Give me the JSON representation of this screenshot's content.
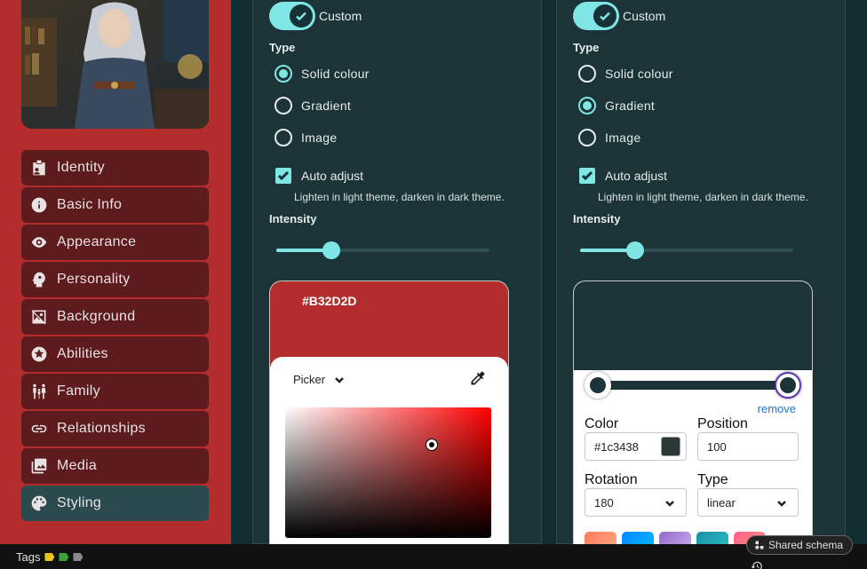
{
  "sidebar": {
    "items": [
      {
        "label": "Identity",
        "icon": "id-badge-icon",
        "active": false
      },
      {
        "label": "Basic Info",
        "icon": "info-icon",
        "active": false
      },
      {
        "label": "Appearance",
        "icon": "eye-icon",
        "active": false
      },
      {
        "label": "Personality",
        "icon": "head-icon",
        "active": false
      },
      {
        "label": "Background",
        "icon": "image-slash-icon",
        "active": false
      },
      {
        "label": "Abilities",
        "icon": "star-icon",
        "active": false
      },
      {
        "label": "Family",
        "icon": "family-icon",
        "active": false
      },
      {
        "label": "Relationships",
        "icon": "link-icon",
        "active": false
      },
      {
        "label": "Media",
        "icon": "photos-icon",
        "active": false
      },
      {
        "label": "Styling",
        "icon": "palette-icon",
        "active": true
      }
    ]
  },
  "panel1": {
    "toggle_label": "Custom",
    "type_label": "Type",
    "options": [
      "Solid colour",
      "Gradient",
      "Image"
    ],
    "selected": "Solid colour",
    "auto_adjust_label": "Auto adjust",
    "auto_adjust_checked": true,
    "auto_adjust_help": "Lighten in light theme, darken in dark theme.",
    "intensity_label": "Intensity",
    "intensity": 0.26,
    "color_hex": "#B32D2D",
    "picker_mode": "Picker"
  },
  "panel2": {
    "toggle_label": "Custom",
    "type_label": "Type",
    "options": [
      "Solid colour",
      "Gradient",
      "Image"
    ],
    "selected": "Gradient",
    "auto_adjust_label": "Auto adjust",
    "auto_adjust_checked": true,
    "auto_adjust_help": "Lighten in light theme, darken in dark theme.",
    "intensity_label": "Intensity",
    "intensity": 0.26,
    "remove_label": "remove",
    "color_label": "Color",
    "color_value": "#1c3438",
    "position_label": "Position",
    "position_value": "100",
    "rotation_label": "Rotation",
    "rotation_value": "180",
    "type_field_label": "Type",
    "type_value": "linear",
    "gradient_color": "#1c3438",
    "preset_colors": [
      [
        "#ff7a59",
        "#ffb088"
      ],
      [
        "#0a84ff",
        "#00c6ff"
      ],
      [
        "#8e6cc9",
        "#d6b4f5"
      ],
      [
        "#1a8fa8",
        "#2ec4c4"
      ],
      [
        "#ff5f8f",
        "#ff9a6b"
      ]
    ]
  },
  "statusbar": {
    "tags_label": "Tags",
    "tag_colors": [
      "#e6c619",
      "#3aa33a",
      "#8a8a8a"
    ],
    "shared_schema_label": "Shared schema"
  },
  "colors": {
    "sidebar_bg": "#b32d2d",
    "nav_bg": "#5e1b1e",
    "nav_active_bg": "#2a4a4e",
    "accent": "#7fe5e5",
    "panel_bg": "#1c3438"
  }
}
